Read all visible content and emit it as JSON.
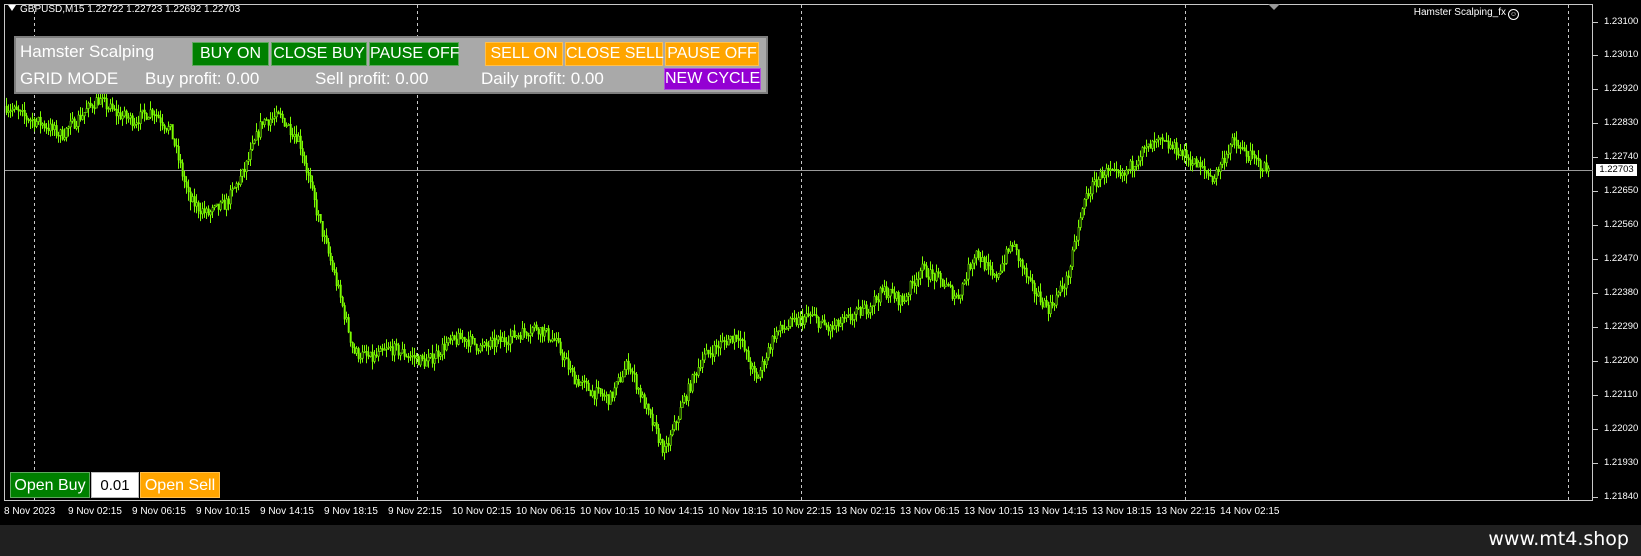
{
  "chart": {
    "symbol_line": "GBPUSD,M15  1.22722 1.22723 1.22692 1.22703",
    "ea_name": "Hamster Scalping_fx",
    "current_price": "1.22703",
    "price_axis": [
      "1.23100",
      "1.23010",
      "1.22920",
      "1.22830",
      "1.22740",
      "1.22650",
      "1.22560",
      "1.22470",
      "1.22380",
      "1.22290",
      "1.22200",
      "1.22110",
      "1.22020",
      "1.21930",
      "1.21840"
    ],
    "time_axis": [
      "8 Nov 2023",
      "9 Nov 02:15",
      "9 Nov 06:15",
      "9 Nov 10:15",
      "9 Nov 14:15",
      "9 Nov 18:15",
      "9 Nov 22:15",
      "10 Nov 02:15",
      "10 Nov 06:15",
      "10 Nov 10:15",
      "10 Nov 14:15",
      "10 Nov 18:15",
      "10 Nov 22:15",
      "13 Nov 02:15",
      "13 Nov 06:15",
      "13 Nov 10:15",
      "13 Nov 14:15",
      "13 Nov 18:15",
      "13 Nov 22:15",
      "14 Nov 02:15"
    ],
    "colors": {
      "candle": "#7cfc00",
      "background": "#000000",
      "grid": "#c8c8c8"
    }
  },
  "chart_data": {
    "type": "line",
    "title": "GBPUSD,M15",
    "ylim": [
      1.2179,
      1.2316
    ],
    "price_path": [
      [
        0,
        1.2288
      ],
      [
        1,
        1.2285
      ],
      [
        2,
        1.2283
      ],
      [
        3,
        1.228
      ],
      [
        4,
        1.2285
      ],
      [
        5,
        1.229
      ],
      [
        6,
        1.2286
      ],
      [
        7,
        1.2284
      ],
      [
        8,
        1.2287
      ],
      [
        9,
        1.2281
      ],
      [
        10,
        1.2262
      ],
      [
        11,
        1.2258
      ],
      [
        12,
        1.2261
      ],
      [
        13,
        1.227
      ],
      [
        14,
        1.2284
      ],
      [
        15,
        1.2285
      ],
      [
        16,
        1.2279
      ],
      [
        17,
        1.2258
      ],
      [
        18,
        1.224
      ],
      [
        19,
        1.222
      ],
      [
        20,
        1.2218
      ],
      [
        21,
        1.2221
      ],
      [
        22,
        1.2219
      ],
      [
        23,
        1.2217
      ],
      [
        24,
        1.2222
      ],
      [
        25,
        1.2224
      ],
      [
        26,
        1.2221
      ],
      [
        27,
        1.2223
      ],
      [
        28,
        1.2225
      ],
      [
        29,
        1.2227
      ],
      [
        30,
        1.2223
      ],
      [
        31,
        1.2213
      ],
      [
        32,
        1.2209
      ],
      [
        33,
        1.2207
      ],
      [
        34,
        1.2217
      ],
      [
        35,
        1.2204
      ],
      [
        36,
        1.2192
      ],
      [
        37,
        1.2206
      ],
      [
        38,
        1.2218
      ],
      [
        39,
        1.2222
      ],
      [
        40,
        1.2225
      ],
      [
        41,
        1.2212
      ],
      [
        42,
        1.2225
      ],
      [
        43,
        1.2228
      ],
      [
        44,
        1.223
      ],
      [
        45,
        1.2226
      ],
      [
        46,
        1.2229
      ],
      [
        47,
        1.2232
      ],
      [
        48,
        1.2237
      ],
      [
        49,
        1.2234
      ],
      [
        50,
        1.2243
      ],
      [
        51,
        1.224
      ],
      [
        52,
        1.2235
      ],
      [
        53,
        1.2248
      ],
      [
        54,
        1.224
      ],
      [
        55,
        1.225
      ],
      [
        56,
        1.2238
      ],
      [
        57,
        1.2232
      ],
      [
        58,
        1.224
      ],
      [
        59,
        1.2263
      ],
      [
        60,
        1.227
      ],
      [
        61,
        1.2268
      ],
      [
        62,
        1.2275
      ],
      [
        63,
        1.2278
      ],
      [
        64,
        1.2276
      ],
      [
        65,
        1.2272
      ],
      [
        66,
        1.2268
      ],
      [
        67,
        1.2278
      ],
      [
        68,
        1.2274
      ],
      [
        69,
        1.227
      ]
    ]
  },
  "panel": {
    "title": "Hamster Scalping",
    "mode": "GRID MODE",
    "buy_on": "BUY ON",
    "close_buy": "CLOSE BUY",
    "pause_off_buy": "PAUSE OFF",
    "sell_on": "SELL ON",
    "close_sell": "CLOSE SELL",
    "pause_off_sell": "PAUSE OFF",
    "buy_profit": "Buy profit: 0.00",
    "sell_profit": "Sell profit: 0.00",
    "daily_profit": "Daily profit: 0.00",
    "new_cycle": "NEW CYCLE"
  },
  "trade": {
    "open_buy": "Open Buy",
    "lot": "0.01",
    "open_sell": "Open Sell"
  },
  "footer": {
    "url": "www.mt4.shop"
  }
}
